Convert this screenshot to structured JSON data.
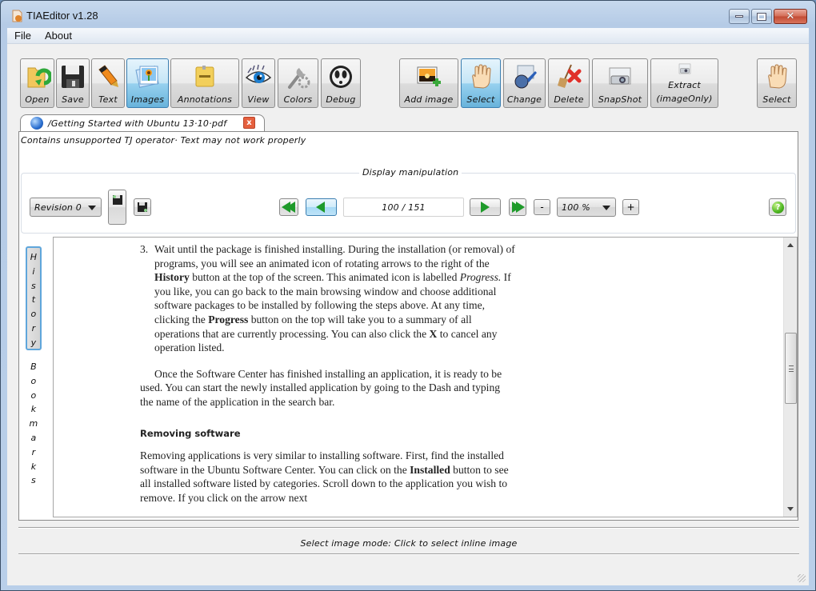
{
  "window": {
    "title": "TIAEditor v1.28",
    "controls": {
      "minimize": "minimize",
      "maximize": "maximize",
      "close": "✕"
    }
  },
  "menu": [
    "File",
    "About"
  ],
  "toolbar_left": [
    {
      "label": "Open",
      "icon": "folder-open-icon",
      "active": false
    },
    {
      "label": "Save",
      "icon": "floppy-disk-icon",
      "active": false
    },
    {
      "label": "Text",
      "icon": "marker-pen-icon",
      "active": false
    },
    {
      "label": "Images",
      "icon": "picture-icon",
      "active": true
    },
    {
      "label": "Annotations",
      "icon": "sticky-note-icon",
      "active": false
    },
    {
      "label": "View",
      "icon": "eye-icon",
      "active": false
    },
    {
      "label": "Colors",
      "icon": "wrench-gear-icon",
      "active": false
    },
    {
      "label": "Debug",
      "icon": "ghost-face-icon",
      "active": false
    }
  ],
  "toolbar_right": [
    {
      "label": "Add image",
      "icon": "add-image-icon",
      "active": false
    },
    {
      "label": "Select",
      "icon": "hand-icon",
      "active": true
    },
    {
      "label": "Change",
      "icon": "change-image-icon",
      "active": false
    },
    {
      "label": "Delete",
      "icon": "broom-delete-icon",
      "active": false
    },
    {
      "label": "SnapShot",
      "icon": "projector-icon",
      "active": false
    },
    {
      "label": "Extract",
      "label2": "(imageOnly)",
      "icon": "projector-small-icon",
      "active": false
    }
  ],
  "toolbar_far_right": {
    "label": "Select",
    "icon": "hand-icon"
  },
  "document_tab": {
    "title": "/Getting Started with Ubuntu 13·10·pdf",
    "close": "x"
  },
  "warning": "Contains unsupported TJ operator· Text may not work properly",
  "display_manipulation": {
    "title": "Display manipulation",
    "revision": "Revision 0",
    "page_current": 100,
    "page_total": 151,
    "page_display": "100 / 151",
    "zoom": "100 %",
    "zoom_minus": "-",
    "zoom_plus": "+",
    "help": "?"
  },
  "side_tabs": {
    "history": "History",
    "bookmarks": "Bookmarks"
  },
  "page_content": {
    "item_number": "3.",
    "item_text": [
      {
        "t": "Wait until the package is finished installing. During the installation (or removal) of programs, you will see an animated icon of rotating arrows to the right of the "
      },
      {
        "b": "History"
      },
      {
        "t": " button at the top of the screen. This animated icon is labelled "
      },
      {
        "i": "Progress."
      },
      {
        "t": " If you like, you can go back to the main browsing window and choose additional software packages to be installed by following the steps above. At any time, clicking the "
      },
      {
        "b": "Progress"
      },
      {
        "t": " button on the top will take you to a summary of all operations that are currently processing. You can also click the "
      },
      {
        "b": "X"
      },
      {
        "t": " to cancel any operation listed."
      }
    ],
    "paragraph2": "Once the Software Center has finished installing an application, it is ready to be used. You can start the newly installed application by going to the Dash and typing the name of the application in the search bar.",
    "heading": "Removing software",
    "paragraph3": [
      {
        "t": "Removing applications is very similar to installing software. First, find the installed software in the Ubuntu Software Center. You can click on the "
      },
      {
        "b": "Installed"
      },
      {
        "t": " button to see all installed software listed by categories. Scroll down to the application you wish to remove. If you click on the arrow next"
      }
    ]
  },
  "scroll": {
    "position_fraction": 0.45
  },
  "status": "Select image mode: Click to select inline image"
}
